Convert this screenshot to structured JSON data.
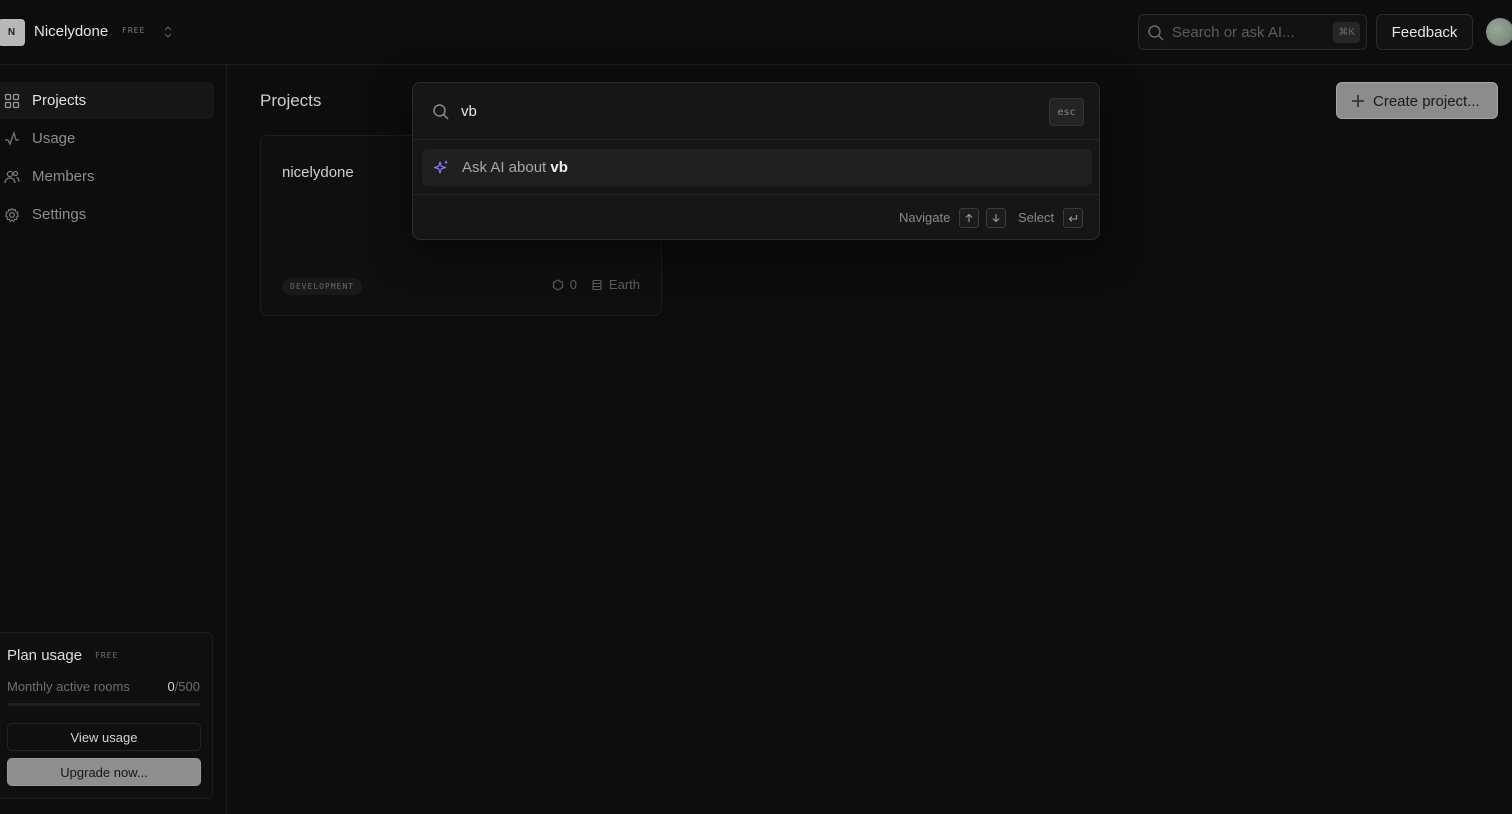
{
  "header": {
    "org_initial": "N",
    "org_name": "Nicelydone",
    "org_plan_badge": "FREE",
    "search_placeholder": "Search or ask AI...",
    "search_shortcut": "⌘K",
    "feedback_label": "Feedback"
  },
  "sidebar": {
    "items": [
      {
        "label": "Projects",
        "icon": "grid-icon",
        "active": true
      },
      {
        "label": "Usage",
        "icon": "activity-icon",
        "active": false
      },
      {
        "label": "Members",
        "icon": "users-icon",
        "active": false
      },
      {
        "label": "Settings",
        "icon": "gear-icon",
        "active": false
      }
    ],
    "plan": {
      "title": "Plan usage",
      "badge": "FREE",
      "metric_label": "Monthly active rooms",
      "used": "0",
      "limit": "/500",
      "progress": 0,
      "view_usage_label": "View usage",
      "upgrade_label": "Upgrade now..."
    }
  },
  "main": {
    "title": "Projects",
    "create_label": "Create project...",
    "projects": [
      {
        "name": "nicelydone",
        "environment": "DEVELOPMENT",
        "rooms": "0",
        "region": "Earth"
      }
    ]
  },
  "palette": {
    "query": "vb",
    "esc_label": "esc",
    "result_prefix": "Ask AI about ",
    "result_term": "vb",
    "navigate_label": "Navigate",
    "select_label": "Select"
  },
  "colors": {
    "background": "#0d0d0d",
    "accent_ai": "#8b7cf6",
    "button_primary": "#8c8c8c"
  }
}
